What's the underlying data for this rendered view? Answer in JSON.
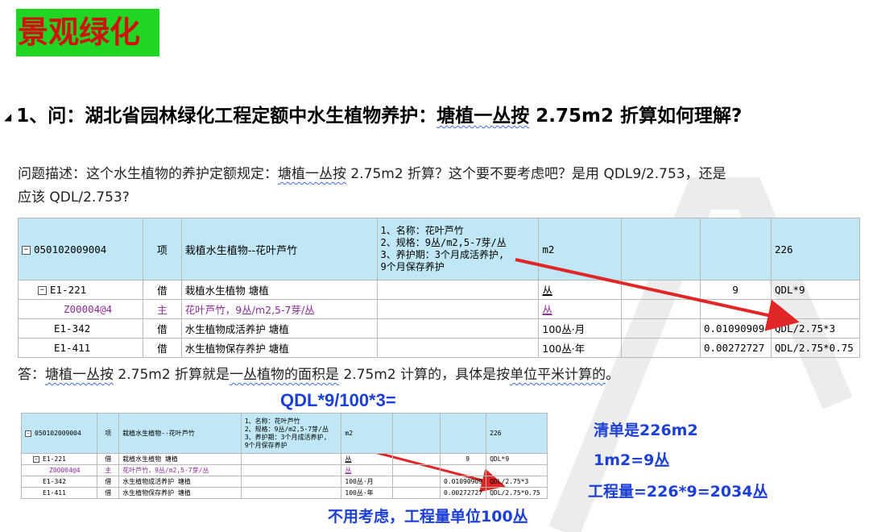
{
  "title": "景观绿化",
  "question": {
    "prefix": "1、问：湖北省园林绿化工程定额中水生植物养护：",
    "highlight": "塘植一丛按",
    "suffix": " 2.75m2 折算如何理解?"
  },
  "description": {
    "line1_a": "问题描述：这个水生植物的养护定额规定：",
    "line1_hl": "塘植一丛按",
    "line1_b": " 2.75m2 折算？这个要不要考虑吧？是用 QDL9/2.753，还是",
    "line2": "应该 QDL/2.753?"
  },
  "table_main": {
    "header": {
      "code": "050102009004",
      "type": "项",
      "name": "栽植水生植物--花叶芦竹",
      "features": [
        "1、名称：花叶芦竹",
        "2、规格：9丛/m2,5-7芽/丛",
        "3、养护期：3个月成活养护,",
        "9个月保存养护"
      ],
      "unit": "m2",
      "col6": "",
      "qty": "",
      "expr": "226"
    },
    "rows": [
      {
        "code": "E1-221",
        "type": "借",
        "name": "栽植水生植物 塘植",
        "unit": "丛",
        "qty": "9",
        "expr": "QDL*9"
      },
      {
        "code": "Z00004@4",
        "type": "主",
        "name": "花叶芦竹，9丛/m2,5-7芽/丛",
        "unit": "丛",
        "qty": "",
        "expr": ""
      },
      {
        "code": "E1-342",
        "type": "借",
        "name": "水生植物成活养护 塘植",
        "unit": "100丛·月",
        "qty": "0.01090909",
        "expr": "QDL/2.75*3"
      },
      {
        "code": "E1-411",
        "type": "借",
        "name": "水生植物保存养护 塘植",
        "unit": "100丛·年",
        "qty": "0.00272727",
        "expr": "QDL/2.75*0.75"
      }
    ]
  },
  "answer": {
    "a": "答：",
    "hl1": "塘植一丛按",
    "b": " 2.75m2 折算就是",
    "hl2": "一丛植物的面积是",
    "c": " 2.75m2 计算的，具体是按",
    "hl3": "单位平米计算的",
    "d": "。"
  },
  "formula": "QDL*9/100*3=",
  "notes": {
    "n1": "清单是226m2",
    "n2": "1m2=9丛",
    "n3": "工程量=226*9=2034丛",
    "n4": "不用考虑，工程量单位100丛"
  },
  "colors": {
    "badge_bg": "#21d623",
    "badge_text": "#d21010",
    "table_header": "#bfe7f6",
    "arrow": "#e02626",
    "note": "#1c3fd6"
  }
}
